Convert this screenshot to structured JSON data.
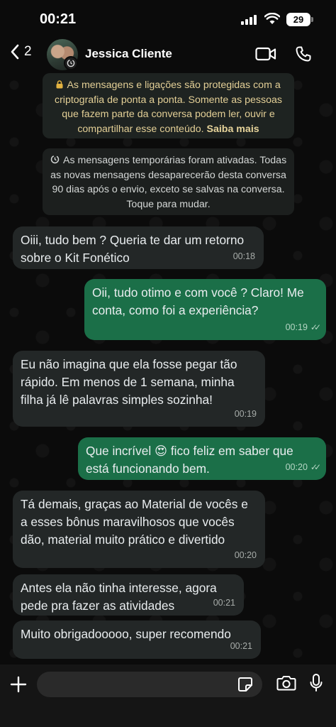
{
  "status": {
    "time": "00:21",
    "battery": "29"
  },
  "header": {
    "back_count": "2",
    "contact_name": "Jessica Cliente"
  },
  "notices": {
    "encryption_text": "As mensagens e ligações são protegidas com a criptografia de ponta a ponta. Somente as pessoas que fazem parte da conversa podem ler, ouvir e compartilhar esse conteúdo.",
    "encryption_link": "Saiba mais",
    "temporary_text": "As mensagens temporárias foram ativadas. Todas as novas mensagens desaparecerão desta conversa 90 dias após o envio, exceto se salvas na conversa. Toque para mudar."
  },
  "messages": [
    {
      "direction": "in",
      "text": "Oiii, tudo bem ? Queria te dar um retorno sobre o Kit Fonético",
      "time": "00:18"
    },
    {
      "direction": "out",
      "text": "Oii, tudo otimo e com você ? Claro! Me conta, como foi a experiência?",
      "time": "00:19"
    },
    {
      "direction": "in",
      "text": "Eu não imagina que ela fosse pegar tão rápido. Em menos de 1 semana, minha filha já lê palavras simples sozinha!",
      "time": "00:19"
    },
    {
      "direction": "out",
      "text": "Que incrível 😍 fico feliz em saber que está funcionando bem.",
      "time": "00:20"
    },
    {
      "direction": "in",
      "text": "Tá demais, graças ao Material de vocês e a esses bônus maravilhosos que vocês dão, material muito prático e divertido",
      "time": "00:20"
    },
    {
      "direction": "in",
      "text": "Antes ela não tinha interesse, agora pede pra fazer as atividades",
      "time": "00:21"
    },
    {
      "direction": "in",
      "text": "Muito obrigadooooo, super recomendo",
      "time": "00:21"
    }
  ],
  "input": {
    "placeholder": ""
  },
  "colors": {
    "outgoing_bubble": "#1b6f48",
    "incoming_bubble": "#232727",
    "notice_text": "#e3cf96"
  },
  "icons": [
    "back-chevron-icon",
    "video-call-icon",
    "phone-icon",
    "lock-icon",
    "timer-icon",
    "plus-icon",
    "sticker-icon",
    "camera-icon",
    "microphone-icon",
    "read-ticks-icon"
  ]
}
